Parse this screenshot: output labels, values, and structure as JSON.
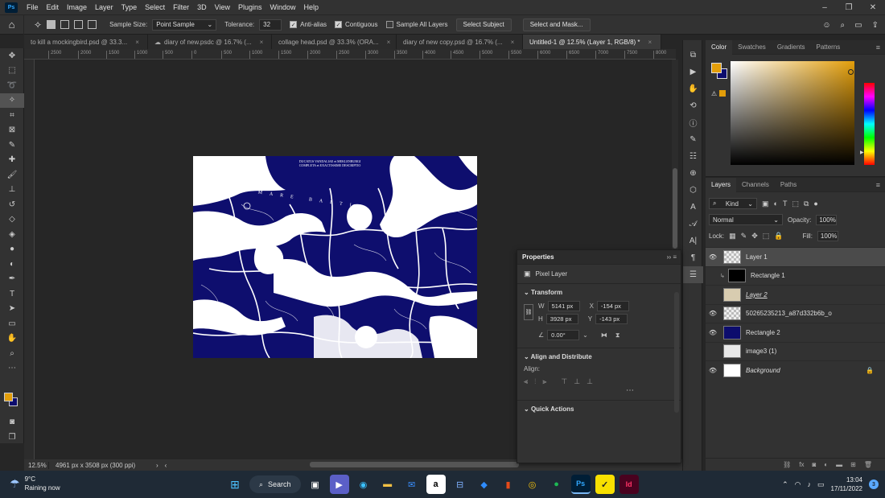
{
  "app": {
    "menu": [
      "File",
      "Edit",
      "Image",
      "Layer",
      "Type",
      "Select",
      "Filter",
      "3D",
      "View",
      "Plugins",
      "Window",
      "Help"
    ]
  },
  "options": {
    "sample_size_label": "Sample Size:",
    "sample_size_value": "Point Sample",
    "tolerance_label": "Tolerance:",
    "tolerance_value": "32",
    "anti_alias": "Anti-alias",
    "contiguous": "Contiguous",
    "sample_all_layers": "Sample All Layers",
    "select_subject": "Select Subject",
    "select_and_mask": "Select and Mask..."
  },
  "tabs": [
    {
      "label": "to kill a mockingbird.psd @ 33.3..."
    },
    {
      "label": "diary of new.psdc @ 16.7% (..."
    },
    {
      "label": "collage head.psd @ 33.3% (ORA..."
    },
    {
      "label": "diary of new copy.psd @ 16.7% (..."
    },
    {
      "label": "Untitled-1 @ 12.5% (Layer 1, RGB/8) *"
    }
  ],
  "ruler": [
    "2500",
    "2000",
    "1500",
    "1000",
    "500",
    "0",
    "500",
    "1000",
    "1500",
    "2000",
    "2500",
    "3000",
    "3500",
    "4000",
    "4500",
    "5000",
    "5500",
    "6000",
    "6500",
    "7000",
    "7500",
    "8000"
  ],
  "document": {
    "title_text": "DUCATUS VANDALIAE et MEKLENBURGI COMPLETA et EXACTISSIME DESCRIPTIO",
    "sea_text": "MARE BALTIC"
  },
  "status": {
    "zoom": "12.5%",
    "dimensions": "4961 px x 3508 px (300 ppi)"
  },
  "color_panel": {
    "tabs": [
      "Color",
      "Swatches",
      "Gradients",
      "Patterns"
    ]
  },
  "layers_panel": {
    "tabs": [
      "Layers",
      "Channels",
      "Paths"
    ],
    "kind": "Kind",
    "blend_mode": "Normal",
    "opacity_label": "Opacity:",
    "opacity_value": "100%",
    "lock_label": "Lock:",
    "fill_label": "Fill:",
    "fill_value": "100%",
    "layers": [
      {
        "name": "Layer 1",
        "visible": true,
        "selected": true
      },
      {
        "name": "Rectangle 1",
        "visible": false
      },
      {
        "name": "Layer 2",
        "visible": false
      },
      {
        "name": "50265235213_a87d332b6b_o",
        "visible": true
      },
      {
        "name": "Rectangle 2",
        "visible": true
      },
      {
        "name": "image3 (1)",
        "visible": false
      },
      {
        "name": "Background",
        "visible": true,
        "locked": true
      }
    ]
  },
  "properties": {
    "title": "Properties",
    "type": "Pixel Layer",
    "transform_title": "Transform",
    "w_label": "W",
    "w_value": "5141 px",
    "x_label": "X",
    "x_value": "-154 px",
    "h_label": "H",
    "h_value": "3928 px",
    "y_label": "Y",
    "y_value": "-143 px",
    "angle_value": "0.00°",
    "align_title": "Align and Distribute",
    "align_label": "Align:",
    "quick_actions": "Quick Actions"
  },
  "taskbar": {
    "temp": "9°C",
    "weather": "Raining now",
    "search": "Search",
    "time": "13:04",
    "date": "17/11/2022",
    "notifications": "3"
  }
}
